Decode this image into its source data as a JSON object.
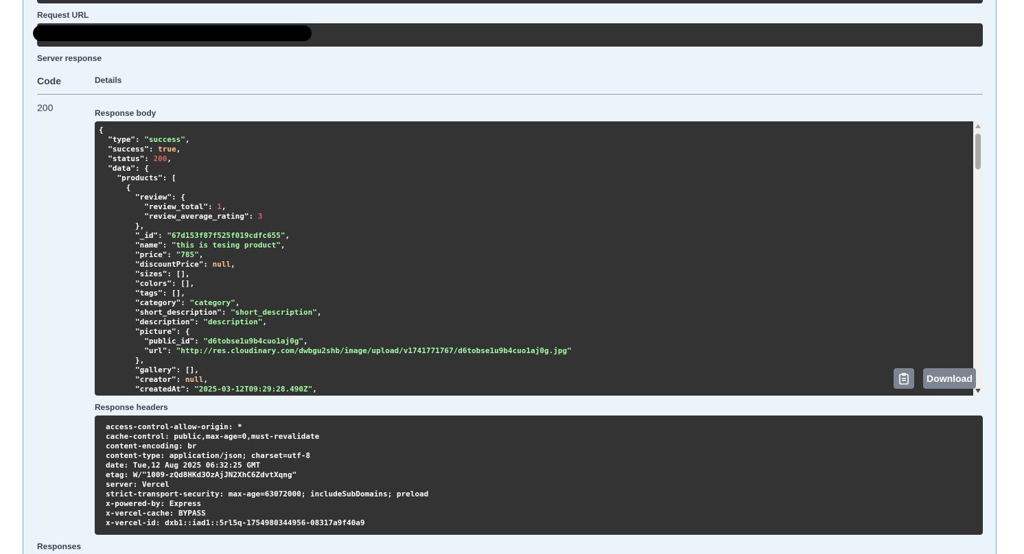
{
  "labels": {
    "request_url": "Request URL",
    "server_response": "Server response",
    "code": "Code",
    "details": "Details",
    "response_body": "Response body",
    "response_headers": "Response headers",
    "responses": "Responses"
  },
  "response": {
    "code": "200"
  },
  "buttons": {
    "copy_icon": "clipboard-icon",
    "download_label": "Download"
  },
  "json_lines": [
    [
      [
        "{",
        "k"
      ]
    ],
    [
      [
        "  \"type\"",
        "k"
      ],
      [
        ": ",
        "k"
      ],
      [
        "\"success\"",
        "s"
      ],
      [
        ",",
        "k"
      ]
    ],
    [
      [
        "  \"success\"",
        "k"
      ],
      [
        ": ",
        "k"
      ],
      [
        "true",
        "b"
      ],
      [
        ",",
        "k"
      ]
    ],
    [
      [
        "  \"status\"",
        "k"
      ],
      [
        ": ",
        "k"
      ],
      [
        "200",
        "n"
      ],
      [
        ",",
        "k"
      ]
    ],
    [
      [
        "  \"data\"",
        "k"
      ],
      [
        ": {",
        "k"
      ]
    ],
    [
      [
        "    \"products\"",
        "k"
      ],
      [
        ": [",
        "k"
      ]
    ],
    [
      [
        "      {",
        "k"
      ]
    ],
    [
      [
        "        \"review\"",
        "k"
      ],
      [
        ": {",
        "k"
      ]
    ],
    [
      [
        "          \"review_total\"",
        "k"
      ],
      [
        ": ",
        "k"
      ],
      [
        "1",
        "n"
      ],
      [
        ",",
        "k"
      ]
    ],
    [
      [
        "          \"review_average_rating\"",
        "k"
      ],
      [
        ": ",
        "k"
      ],
      [
        "3",
        "n"
      ]
    ],
    [
      [
        "        },",
        "k"
      ]
    ],
    [
      [
        "        \"_id\"",
        "k"
      ],
      [
        ": ",
        "k"
      ],
      [
        "\"67d153f87f525f019cdfc655\"",
        "s"
      ],
      [
        ",",
        "k"
      ]
    ],
    [
      [
        "        \"name\"",
        "k"
      ],
      [
        ": ",
        "k"
      ],
      [
        "\"this is tesing product\"",
        "s"
      ],
      [
        ",",
        "k"
      ]
    ],
    [
      [
        "        \"price\"",
        "k"
      ],
      [
        ": ",
        "k"
      ],
      [
        "\"785\"",
        "s"
      ],
      [
        ",",
        "k"
      ]
    ],
    [
      [
        "        \"discountPrice\"",
        "k"
      ],
      [
        ": ",
        "k"
      ],
      [
        "null",
        "b"
      ],
      [
        ",",
        "k"
      ]
    ],
    [
      [
        "        \"sizes\"",
        "k"
      ],
      [
        ": [],",
        "k"
      ]
    ],
    [
      [
        "        \"colors\"",
        "k"
      ],
      [
        ": [],",
        "k"
      ]
    ],
    [
      [
        "        \"tags\"",
        "k"
      ],
      [
        ": [],",
        "k"
      ]
    ],
    [
      [
        "        \"category\"",
        "k"
      ],
      [
        ": ",
        "k"
      ],
      [
        "\"category\"",
        "s"
      ],
      [
        ",",
        "k"
      ]
    ],
    [
      [
        "        \"short_description\"",
        "k"
      ],
      [
        ": ",
        "k"
      ],
      [
        "\"short_description\"",
        "s"
      ],
      [
        ",",
        "k"
      ]
    ],
    [
      [
        "        \"description\"",
        "k"
      ],
      [
        ": ",
        "k"
      ],
      [
        "\"description\"",
        "s"
      ],
      [
        ",",
        "k"
      ]
    ],
    [
      [
        "        \"picture\"",
        "k"
      ],
      [
        ": {",
        "k"
      ]
    ],
    [
      [
        "          \"public_id\"",
        "k"
      ],
      [
        ": ",
        "k"
      ],
      [
        "\"d6tobse1u9b4cuo1aj0g\"",
        "s"
      ],
      [
        ",",
        "k"
      ]
    ],
    [
      [
        "          \"url\"",
        "k"
      ],
      [
        ": ",
        "k"
      ],
      [
        "\"http://res.cloudinary.com/dwbgu2shb/image/upload/v1741771767/d6tobse1u9b4cuo1aj0g.jpg\"",
        "s"
      ]
    ],
    [
      [
        "        },",
        "k"
      ]
    ],
    [
      [
        "        \"gallery\"",
        "k"
      ],
      [
        ": [],",
        "k"
      ]
    ],
    [
      [
        "        \"creator\"",
        "k"
      ],
      [
        ": ",
        "k"
      ],
      [
        "null",
        "b"
      ],
      [
        ",",
        "k"
      ]
    ],
    [
      [
        "        \"createdAt\"",
        "k"
      ],
      [
        ": ",
        "k"
      ],
      [
        "\"2025-03-12T09:29:28.490Z\"",
        "s"
      ],
      [
        ",",
        "k"
      ]
    ]
  ],
  "headers_lines": [
    "access-control-allow-origin: *",
    "cache-control: public,max-age=0,must-revalidate",
    "content-encoding: br",
    "content-type: application/json; charset=utf-8",
    "date: Tue,12 Aug 2025 06:32:25 GMT",
    "etag: W/\"1009-zQd8HKd3OzAjJN2XhC6ZdvtXqng\"",
    "server: Vercel",
    "strict-transport-security: max-age=63072000; includeSubDomains; preload",
    "x-powered-by: Express",
    "x-vercel-cache: BYPASS",
    "x-vercel-id: dxb1::iad1::5rl5q-1754980344956-08317a9f40a9"
  ],
  "colors": {
    "panel_bg": "#ebf3fb",
    "panel_border": "#61affe",
    "code_bg": "#333333",
    "json_string": "#a2fca2",
    "json_literal": "#fcc28c",
    "json_number": "#d36363",
    "button_bg": "#7d8492"
  }
}
